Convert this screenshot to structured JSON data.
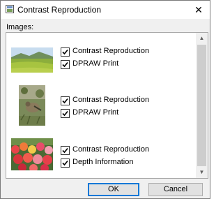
{
  "window": {
    "title": "Contrast Reproduction",
    "close_glyph": "✕"
  },
  "images_label": "Images:",
  "items": [
    {
      "thumbnail": "landscape",
      "options": [
        {
          "label": "Contrast Reproduction",
          "checked": true
        },
        {
          "label": "DPRAW Print",
          "checked": true
        }
      ]
    },
    {
      "thumbnail": "bird",
      "options": [
        {
          "label": "Contrast Reproduction",
          "checked": true
        },
        {
          "label": "DPRAW Print",
          "checked": true
        }
      ]
    },
    {
      "thumbnail": "flowers",
      "options": [
        {
          "label": "Contrast Reproduction",
          "checked": true
        },
        {
          "label": "Depth Information",
          "checked": true
        }
      ]
    }
  ],
  "scrollbar": {
    "up_glyph": "▲",
    "down_glyph": "▼"
  },
  "buttons": {
    "ok": "OK",
    "cancel": "Cancel"
  },
  "colors": {
    "accent": "#0078d7",
    "check": "#000000"
  }
}
